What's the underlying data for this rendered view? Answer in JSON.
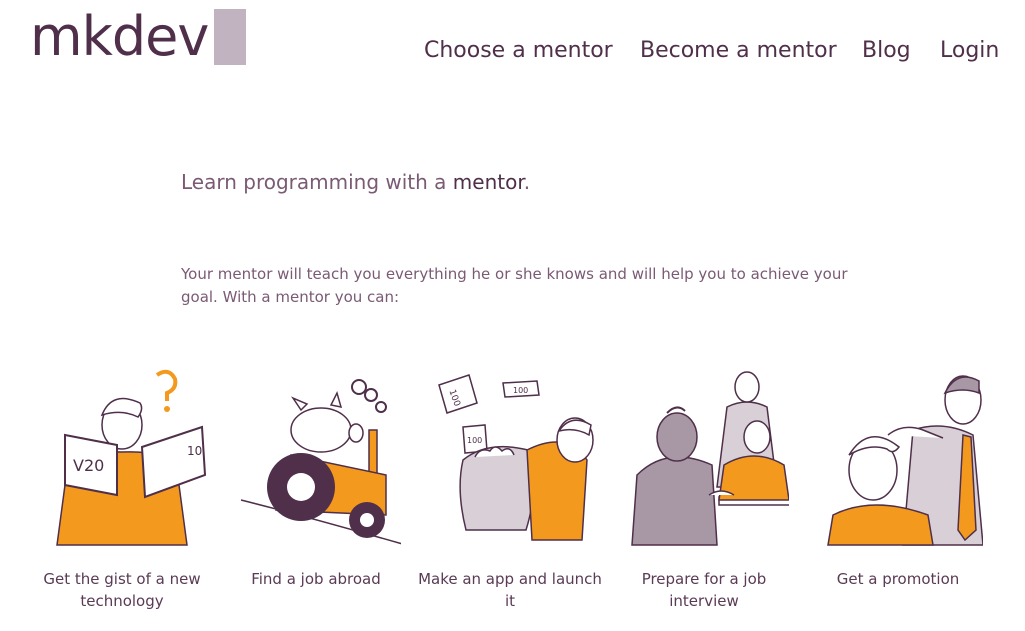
{
  "header": {
    "logo_text": "mkdev",
    "nav": [
      {
        "label": "Choose a mentor"
      },
      {
        "label": "Become a mentor"
      },
      {
        "label": "Blog"
      },
      {
        "label": "Login"
      }
    ]
  },
  "hero": {
    "tagline_prefix": "Learn programming with a ",
    "tagline_highlight": "mentor",
    "tagline_suffix": ".",
    "intro": "Your mentor will teach you everything he or she knows and will help you to achieve your goal. With a mentor you can:"
  },
  "features": [
    {
      "caption": "Get the gist of a new technology",
      "icon": "reading-person-illustration",
      "book_left": "V20",
      "book_right": "10"
    },
    {
      "caption": "Find a job abroad",
      "icon": "pig-on-tractor-illustration"
    },
    {
      "caption": "Make an app and launch it",
      "icon": "money-bag-illustration",
      "bill1": "100",
      "bill2": "100",
      "bill3": "100"
    },
    {
      "caption": "Prepare for a job interview",
      "icon": "interview-illustration"
    },
    {
      "caption": "Get a promotion",
      "icon": "promotion-illustration"
    }
  ],
  "colors": {
    "brand": "#4f2f4a",
    "accent": "#f39a1e",
    "logo_block": "#c2b3c1"
  }
}
